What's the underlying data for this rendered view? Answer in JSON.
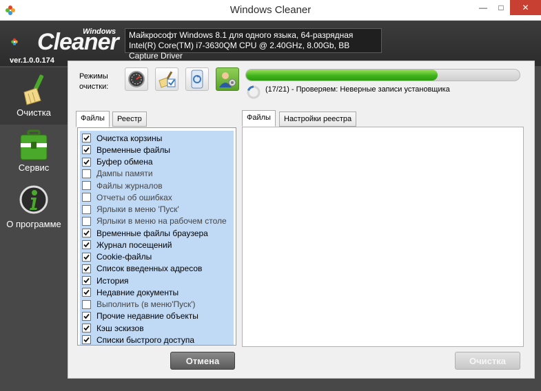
{
  "window": {
    "title": "Windows Cleaner",
    "min_glyph": "—",
    "max_glyph": "□",
    "close_glyph": "✕"
  },
  "header": {
    "logo_windows": "Windows",
    "logo_cleaner": "Cleaner",
    "version": "ver.1.0.0.174",
    "sysinfo_line1": "Майкрософт Windows 8.1 для одного языка, 64-разрядная",
    "sysinfo_line2": "Intel(R) Core(TM) i7-3630QM CPU @ 2.40GHz, 8.00Gb, BB Capture Driver"
  },
  "sidebar": {
    "items": [
      {
        "label": "Очистка",
        "icon": "broom-icon",
        "active": true
      },
      {
        "label": "Сервис",
        "icon": "toolbox-icon",
        "active": false
      },
      {
        "label": "О программе",
        "icon": "info-icon",
        "active": false
      }
    ]
  },
  "modes": {
    "label_line1": "Режимы",
    "label_line2": "очистки:",
    "buttons": [
      "gauge-icon",
      "broom-check-icon",
      "registry-icon",
      "user-settings-icon"
    ],
    "selected_index": 3
  },
  "progress": {
    "fraction": 0.7,
    "status": "(17/21) - Проверяем: Неверные записи установщика"
  },
  "left_tabs": [
    "Файлы",
    "Реестр"
  ],
  "right_tabs": [
    "Файлы",
    "Настройки реестра"
  ],
  "file_items": [
    {
      "label": "Очистка корзины",
      "checked": true
    },
    {
      "label": "Временные файлы",
      "checked": true
    },
    {
      "label": "Буфер обмена",
      "checked": true
    },
    {
      "label": "Дампы памяти",
      "checked": false
    },
    {
      "label": "Файлы журналов",
      "checked": false
    },
    {
      "label": "Отчеты об ошибках",
      "checked": false
    },
    {
      "label": "Ярлыки в меню 'Пуск'",
      "checked": false
    },
    {
      "label": "Ярлыки в меню на рабочем столе",
      "checked": false
    },
    {
      "label": "Временные файлы браузера",
      "checked": true
    },
    {
      "label": "Журнал посещений",
      "checked": true
    },
    {
      "label": "Cookie-файлы",
      "checked": true
    },
    {
      "label": "Список введенных адресов",
      "checked": true
    },
    {
      "label": "История",
      "checked": true
    },
    {
      "label": "Недавние документы",
      "checked": true
    },
    {
      "label": "Выполнить (в меню'Пуск')",
      "checked": false
    },
    {
      "label": "Прочие недавние объекты",
      "checked": true
    },
    {
      "label": "Кэш эскизов",
      "checked": true
    },
    {
      "label": "Списки быстрого доступа",
      "checked": true
    }
  ],
  "buttons": {
    "cancel": "Отмена",
    "clean": "Очистка"
  },
  "colors": {
    "frame": "#484848",
    "list_selection": "#c0d9f5",
    "progress_green": "#3fb51c",
    "close_red": "#c84031"
  }
}
